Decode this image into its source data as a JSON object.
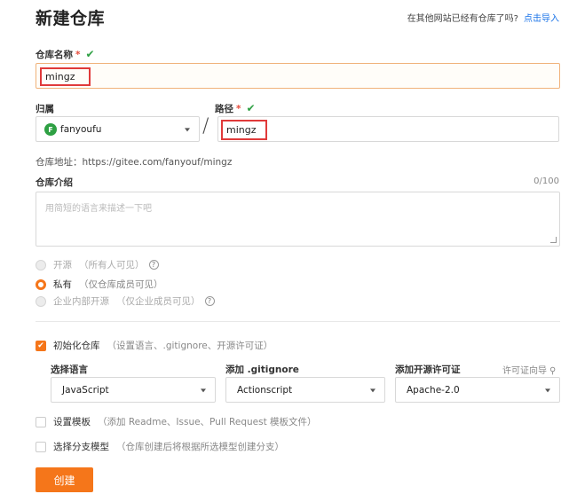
{
  "header": {
    "title": "新建仓库",
    "import_prompt": "在其他网站已经有仓库了吗?",
    "import_link": "点击导入"
  },
  "repo_name": {
    "label": "仓库名称",
    "required_mark": "*",
    "check": "✔",
    "value": "mingz"
  },
  "owner": {
    "label": "归属",
    "avatar_letter": "F",
    "value": "fanyoufu"
  },
  "separator": "/",
  "path": {
    "label": "路径",
    "required_mark": "*",
    "check": "✔",
    "value": "mingz"
  },
  "repo_address": {
    "text": "仓库地址：https://gitee.com/fanyouf/mingz"
  },
  "intro": {
    "label": "仓库介绍",
    "counter": "0/100",
    "placeholder": "用简短的语言来描述一下吧"
  },
  "visibility": {
    "options": [
      {
        "label": "开源",
        "hint": "（所有人可见）",
        "help": "?"
      },
      {
        "label": "私有",
        "hint": "（仅仓库成员可见）",
        "help": ""
      },
      {
        "label": "企业内部开源",
        "hint": "（仅企业成员可见）",
        "help": "?"
      }
    ]
  },
  "init": {
    "label": "初始化仓库",
    "hint": "（设置语言、.gitignore、开源许可证）",
    "check": "✔",
    "language_label": "选择语言",
    "language_value": "JavaScript",
    "gitignore_label": "添加 .gitignore",
    "gitignore_value": "Actionscript",
    "license_label": "添加开源许可证",
    "license_value": "Apache-2.0",
    "license_guide": "许可证向导",
    "license_guide_icon": "⚲"
  },
  "template": {
    "label": "设置模板",
    "hint": "（添加 Readme、Issue、Pull Request 模板文件）"
  },
  "branch_model": {
    "label": "选择分支模型",
    "hint": "（仓库创建后将根据所选模型创建分支）"
  },
  "submit": {
    "label": "创建"
  },
  "colors": {
    "accent": "#f5761a",
    "link": "#1a73e8",
    "success": "#2ea043",
    "highlight_box": "#e03a3a"
  }
}
